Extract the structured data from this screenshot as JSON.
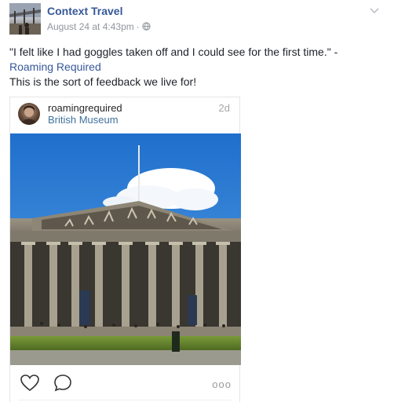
{
  "post": {
    "page_name": "Context Travel",
    "timestamp": "August 24 at 4:43pm",
    "separator": "·",
    "privacy_icon": "globe-icon",
    "menu_icon": "chevron-down-icon",
    "caption_quote": "\"I felt like I had goggles taken off and I could see for the first time.\" -",
    "caption_link": "Roaming Required",
    "caption_line2": "This is the sort of feedback we live for!"
  },
  "embed": {
    "username": "roamingrequired",
    "location": "British Museum",
    "age": "2d",
    "like_icon": "heart-icon",
    "comment_icon": "comment-icon",
    "more_label": "ooo"
  },
  "colors": {
    "link": "#365899",
    "location": "#3f729b",
    "sky": "#2f7fd3"
  }
}
